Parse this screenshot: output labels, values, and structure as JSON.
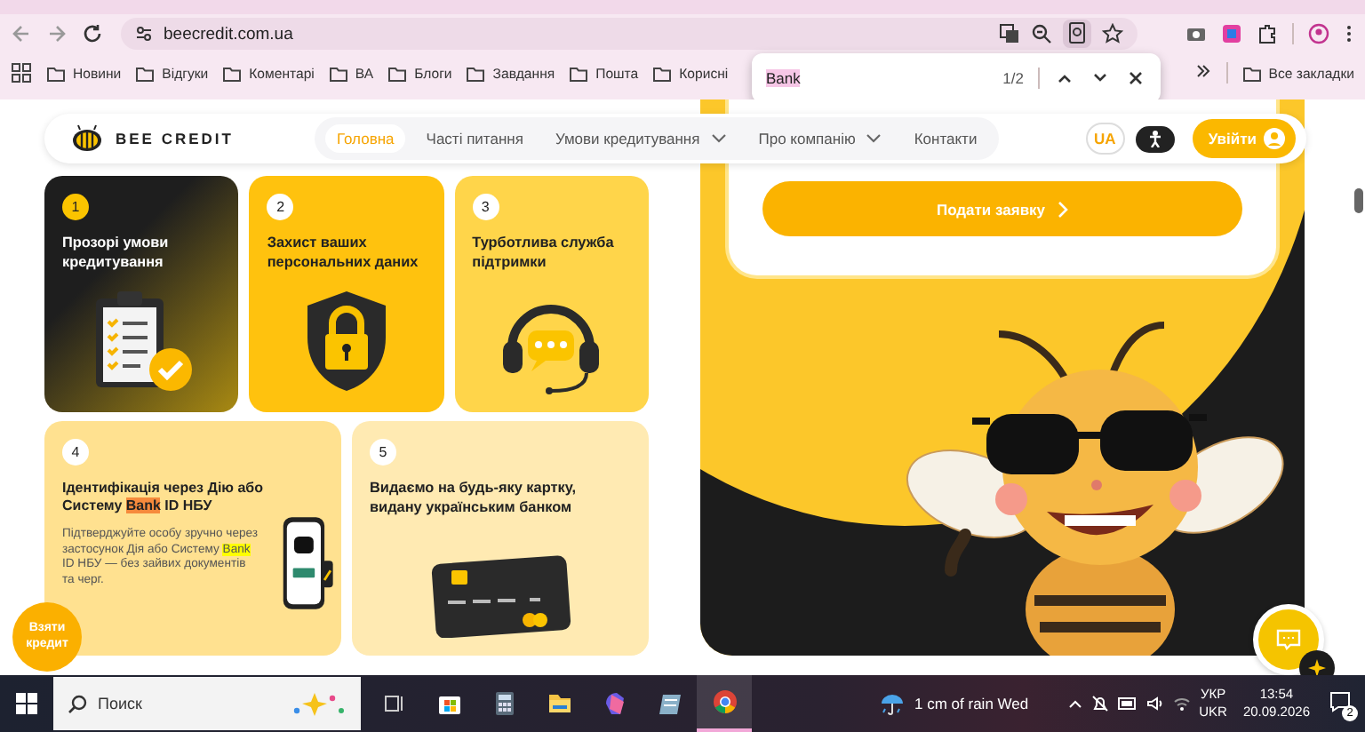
{
  "browser": {
    "address": "beecredit.com.ua",
    "bookmarks": [
      "Новини",
      "Відгуки",
      "Коментарі",
      "ВА",
      "Блоги",
      "Завдання",
      "Пошта",
      "Корисні"
    ],
    "all_bookmarks": "Все закладки",
    "find_bar": {
      "query": "Bank",
      "count": "1/2"
    }
  },
  "header": {
    "logo": "BEE CREDIT",
    "nav": [
      {
        "label": "Головна",
        "selected": true,
        "dropdown": false
      },
      {
        "label": "Часті питання",
        "selected": false,
        "dropdown": false
      },
      {
        "label": "Умови кредитування",
        "selected": false,
        "dropdown": true
      },
      {
        "label": "Про компанію",
        "selected": false,
        "dropdown": true
      },
      {
        "label": "Контакти",
        "selected": false,
        "dropdown": false
      }
    ],
    "language": "UA",
    "login": "Увійти"
  },
  "cards": [
    {
      "number": "1",
      "color": "#1e1e1e",
      "kind": "clipboard",
      "title": [
        {
          "text": "Прозорі умови кредитування",
          "match": false,
          "current": false
        }
      ]
    },
    {
      "number": "2",
      "color": "#ffc20e",
      "kind": "shield",
      "title": [
        {
          "text": "Захист ваших персональних даних",
          "match": false,
          "current": false
        }
      ]
    },
    {
      "number": "3",
      "color": "#ffd54a",
      "kind": "headset",
      "title": [
        {
          "text": "Турботлива служба підтримки",
          "match": false,
          "current": false
        }
      ]
    },
    {
      "number": "4",
      "color": "#ffe190",
      "kind": "phone",
      "title": [
        {
          "text": "Ідентифікація через Дію або Систему ",
          "match": false,
          "current": false
        },
        {
          "text": "Bank",
          "match": true,
          "current": true
        },
        {
          "text": " ID НБУ",
          "match": false,
          "current": false
        }
      ],
      "description": [
        {
          "text": "Підтверджуйте особу зручно через застосунок Дія або Систему ",
          "match": false,
          "current": false
        },
        {
          "text": "Bank",
          "match": true,
          "current": false
        },
        {
          "text": " ID НБУ — без зайвих документів та черг.",
          "match": false,
          "current": false
        }
      ]
    },
    {
      "number": "5",
      "color": "#ffeab2",
      "kind": "bank_card",
      "title": [
        {
          "text": "Видаємо на будь-яку картку, видану українським банком",
          "match": false,
          "current": false
        }
      ]
    }
  ],
  "hero": {
    "apply_button": "Подати заявку"
  },
  "floating": {
    "take_credit": "Взяти кредит"
  },
  "taskbar": {
    "search_placeholder": "Поиск",
    "weather": "1 cm of rain Wed",
    "language": [
      "УКР",
      "UKR"
    ],
    "time": "13:54",
    "date": "20.09.2026",
    "notifications": "2"
  }
}
